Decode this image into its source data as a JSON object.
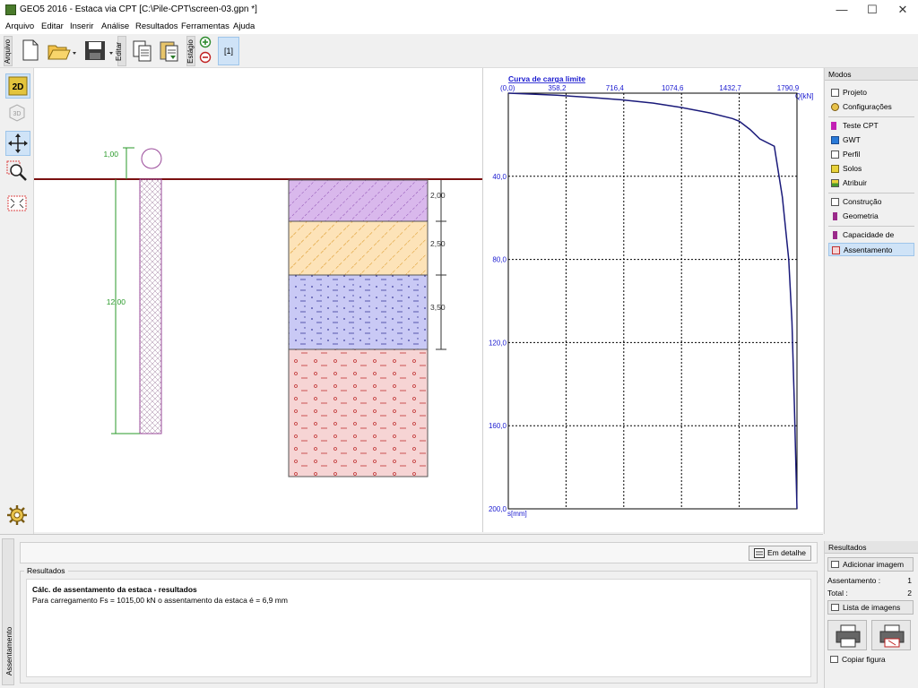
{
  "window": {
    "title": "GEO5 2016 - Estaca via CPT [C:\\Pile-CPT\\screen-03.gpn *]",
    "minimize": "—",
    "maximize": "☐",
    "close": "✕"
  },
  "menu": [
    "Arquivo",
    "Editar",
    "Inserir",
    "Análise",
    "Resultados",
    "Ferramentas",
    "Ajuda"
  ],
  "toolbar": {
    "arquivo_label": "Arquivo",
    "editar_label": "Editar",
    "estagio_label": "Estágio",
    "stage": "[1]"
  },
  "left_tools": {
    "mode_2d": "2D",
    "mode_3d": "3D"
  },
  "drawing": {
    "head_dim": "1,00",
    "pile_length": "12,00",
    "layer_dims": [
      "2,00",
      "2,50",
      "3,50"
    ],
    "layer_colors": [
      "#d9b8ec",
      "#fde3b8",
      "#c9c9f5",
      "#f6d4d4"
    ],
    "ground_color": "#8b0000"
  },
  "chart_data": {
    "type": "line",
    "title": "Curva de carga limite",
    "x_label": "Q[kN]",
    "y_label": "s[mm]",
    "x_origin_label": "(0,0)",
    "x_ticks": [
      "358,2",
      "716,4",
      "1074,6",
      "1432,7",
      "1790,9"
    ],
    "y_ticks": [
      "40,0",
      "80,0",
      "120,0",
      "160,0",
      "200,0"
    ],
    "xlim": [
      0,
      1790.9
    ],
    "ylim": [
      0,
      200
    ],
    "grid": true,
    "series": [
      {
        "color": "#1a1a7a",
        "x": [
          0,
          120,
          300,
          500,
          700,
          900,
          1074.6,
          1250,
          1390,
          1432.7,
          1500,
          1560,
          1650,
          1700,
          1740,
          1760,
          1775,
          1790.9
        ],
        "y": [
          0,
          0.4,
          1.0,
          2.0,
          3.2,
          4.8,
          6.9,
          9.5,
          12.2,
          13.5,
          17.5,
          22.0,
          25.5,
          50,
          80,
          110,
          150,
          200
        ]
      }
    ]
  },
  "modes": {
    "header": "Modos",
    "items": [
      "Projeto",
      "Configurações",
      "Teste CPT",
      "GWT",
      "Perfil",
      "Solos",
      "Atribuir",
      "Construção",
      "Geometria",
      "Capacidade de carga",
      "Assentamento"
    ]
  },
  "bottom": {
    "tab_label": "Assentamento",
    "detail_button": "Em detalhe",
    "results_legend": "Resultados",
    "result_title": "Cálc. de assentamento da estaca - resultados",
    "result_line": "Para carregamento Fs = 1015,00 kN o assentamento da estaca é = 6,9 mm"
  },
  "results_panel": {
    "header": "Resultados",
    "add_image": "Adicionar imagem",
    "assentamento_label": "Assentamento :",
    "assentamento_value": "1",
    "total_label": "Total :",
    "total_value": "2",
    "image_list": "Lista de imagens",
    "copy_figure": "Copiar figura"
  }
}
